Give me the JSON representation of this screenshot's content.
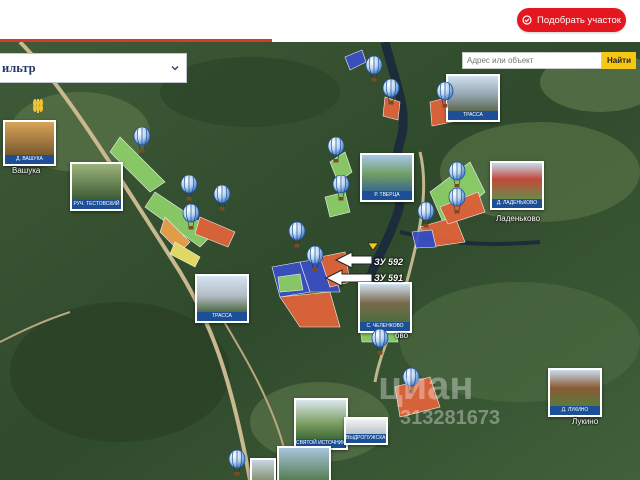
{
  "header": {
    "pick_button_label": "Подобрать участок",
    "pick_icon": "check-circle-icon"
  },
  "filter": {
    "title": "ильтр",
    "chevron_icon": "chevron-down-icon"
  },
  "search": {
    "placeholder": "Адрес или объект",
    "button_label": "Найти"
  },
  "photos": [
    {
      "name": "photo-vashuka",
      "caption": "Д. ВАШУКА"
    },
    {
      "name": "photo-stream-testovsky",
      "caption": "РУЧ. ТЕСТОВСКИЙ"
    },
    {
      "name": "photo-highway-top",
      "caption": "ТРАССА"
    },
    {
      "name": "photo-tvertsa",
      "caption": "Р. ТВЕРЦА"
    },
    {
      "name": "photo-ladenkovo",
      "caption": "Д. ЛАДЕНЬКОВО"
    },
    {
      "name": "photo-highway-mid",
      "caption": "ТРАССА"
    },
    {
      "name": "photo-chelenkovo",
      "caption": "С. ЧЕЛЕНКОВО"
    },
    {
      "name": "photo-lukino",
      "caption": "Д. ЛУКИНО"
    },
    {
      "name": "photo-georgievsky",
      "caption": "СВЯТОЙ ИСТОЧНИК ГЕОРГИЕВСКИЙ"
    },
    {
      "name": "photo-school",
      "caption": "ВЫДРОПУЖСКАЯ ШКОЛА"
    }
  ],
  "places": [
    {
      "name": "place-vashuka",
      "label": "Вашука"
    },
    {
      "name": "place-ladenkovo",
      "label": "Ладеньково"
    },
    {
      "name": "place-lukino",
      "label": "Лукино"
    },
    {
      "name": "place-chelenkovo",
      "label": "ово"
    }
  ],
  "plots": [
    {
      "name": "plot-label-592",
      "label": "ЗУ 592"
    },
    {
      "name": "plot-label-591",
      "label": "ЗУ 591"
    }
  ],
  "watermark": {
    "brand": "циан",
    "phone": "313281673"
  },
  "colors": {
    "accent_red": "#e4161f",
    "caption_blue": "#1c4f96",
    "search_yellow": "#f6c715",
    "filter_text": "#203a66",
    "plot_blue": "#3a4fc8",
    "plot_orange": "#e3643a",
    "plot_green": "#8fd16a"
  }
}
